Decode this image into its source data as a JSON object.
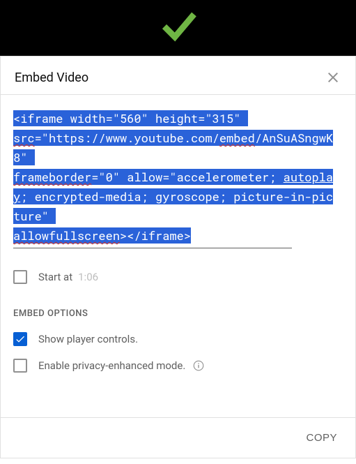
{
  "topbar": {
    "checkmark_color": "#6fb544"
  },
  "dialog": {
    "title": "Embed Video",
    "embed_code_parts": {
      "p1": "<iframe width=\"560\" height=\"315\" ",
      "p2_sq": "src",
      "p3": "=\"https://www.youtube.com/",
      "p4_sq": "embed",
      "p5": "/AnSuASngwK8\" ",
      "p6_sq": "frameborder",
      "p7": "=\"0\" allow=\"accelerometer; ",
      "p8_u": "autoplay",
      "p9": "; encrypted-media; gyroscope; picture-in-picture\" ",
      "p10_sq": "allowfullscreen",
      "p11": "></iframe>"
    },
    "start_at": {
      "label": "Start at",
      "time": "1:06",
      "checked": false
    },
    "embed_options_title": "EMBED OPTIONS",
    "options": {
      "show_controls": {
        "label": "Show player controls.",
        "checked": true
      },
      "privacy_mode": {
        "label": "Enable privacy-enhanced mode.",
        "checked": false
      }
    },
    "copy_label": "COPY"
  }
}
